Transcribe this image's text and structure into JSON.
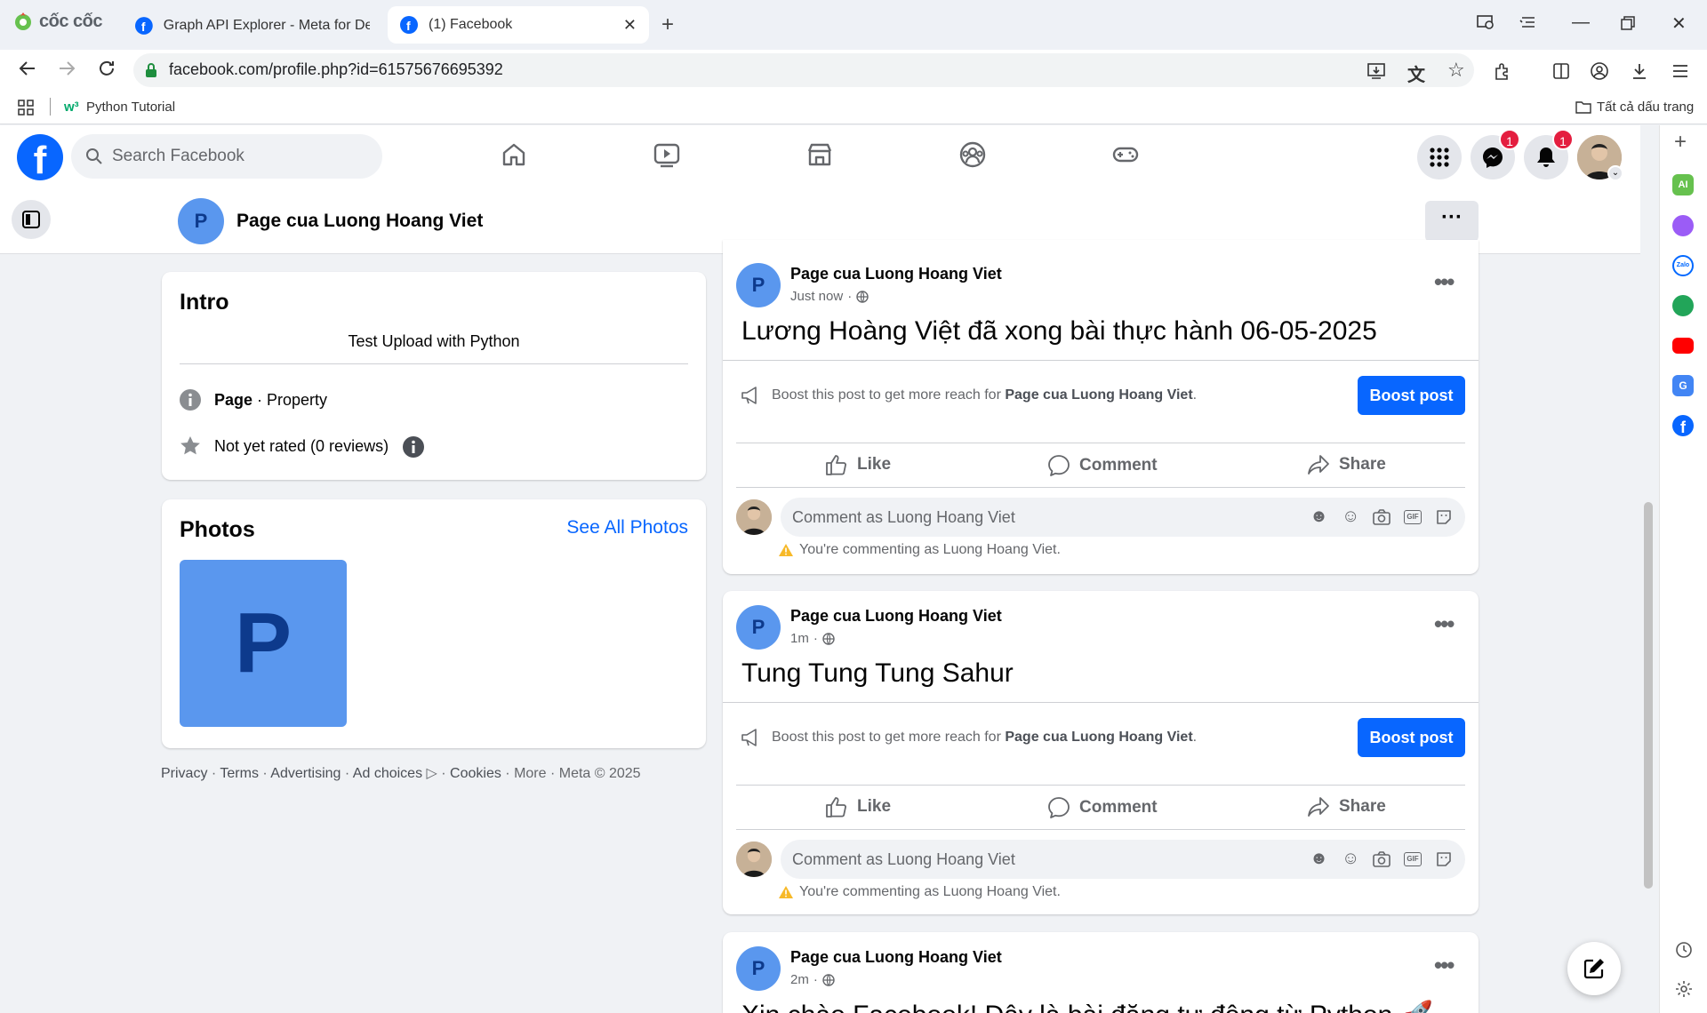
{
  "browser": {
    "brand": "cốc cốc",
    "tabs": [
      {
        "title": "Graph API Explorer - Meta for Developers"
      },
      {
        "title": "(1) Facebook"
      }
    ],
    "url": "facebook.com/profile.php?id=61575676695392",
    "bookmarks": {
      "python_tutorial": "Python Tutorial",
      "all_bookmarks": "Tất cả dấu trang"
    }
  },
  "fb_header": {
    "search_placeholder": "Search Facebook",
    "messenger_badge": "1",
    "notifications_badge": "1"
  },
  "page_bar": {
    "avatar_letter": "P",
    "page_name": "Page cua Luong Hoang Viet",
    "more": "···"
  },
  "intro": {
    "title": "Intro",
    "bio": "Test Upload with Python",
    "category_bold": "Page",
    "category_rest": " · Property",
    "rating": "Not yet rated (0 reviews)"
  },
  "photos": {
    "title": "Photos",
    "see_all": "See All Photos",
    "thumb_letter": "P"
  },
  "footer": {
    "privacy": "Privacy",
    "terms": "Terms",
    "advertising": "Advertising",
    "ad_choices": "Ad choices",
    "cookies": "Cookies",
    "more": "More",
    "meta": "Meta © 2025"
  },
  "posts": [
    {
      "author": "Page cua Luong Hoang Viet",
      "time": "Just now",
      "text": "Lương Hoàng Việt đã xong bài thực hành 06-05-2025",
      "boost_prefix": "Boost this post to get more reach for ",
      "boost_page": "Page cua Luong Hoang Viet",
      "boost_suffix": ".",
      "boost_button": "Boost post",
      "actions": {
        "like": "Like",
        "comment": "Comment",
        "share": "Share"
      },
      "comment_placeholder": "Comment as Luong Hoang Viet",
      "warning": "You're commenting as Luong Hoang Viet."
    },
    {
      "author": "Page cua Luong Hoang Viet",
      "time": "1m",
      "text": "Tung Tung Tung Sahur",
      "boost_prefix": "Boost this post to get more reach for ",
      "boost_page": "Page cua Luong Hoang Viet",
      "boost_suffix": ".",
      "boost_button": "Boost post",
      "actions": {
        "like": "Like",
        "comment": "Comment",
        "share": "Share"
      },
      "comment_placeholder": "Comment as Luong Hoang Viet",
      "warning": "You're commenting as Luong Hoang Viet."
    },
    {
      "author": "Page cua Luong Hoang Viet",
      "time": "2m",
      "text": "Xin chào Facebook! Đây là bài đăng tự động từ Python 🚀"
    }
  ],
  "colors": {
    "fb_blue": "#0866ff",
    "page_avatar": "#5a97ee",
    "badge_red": "#e41e3f"
  }
}
